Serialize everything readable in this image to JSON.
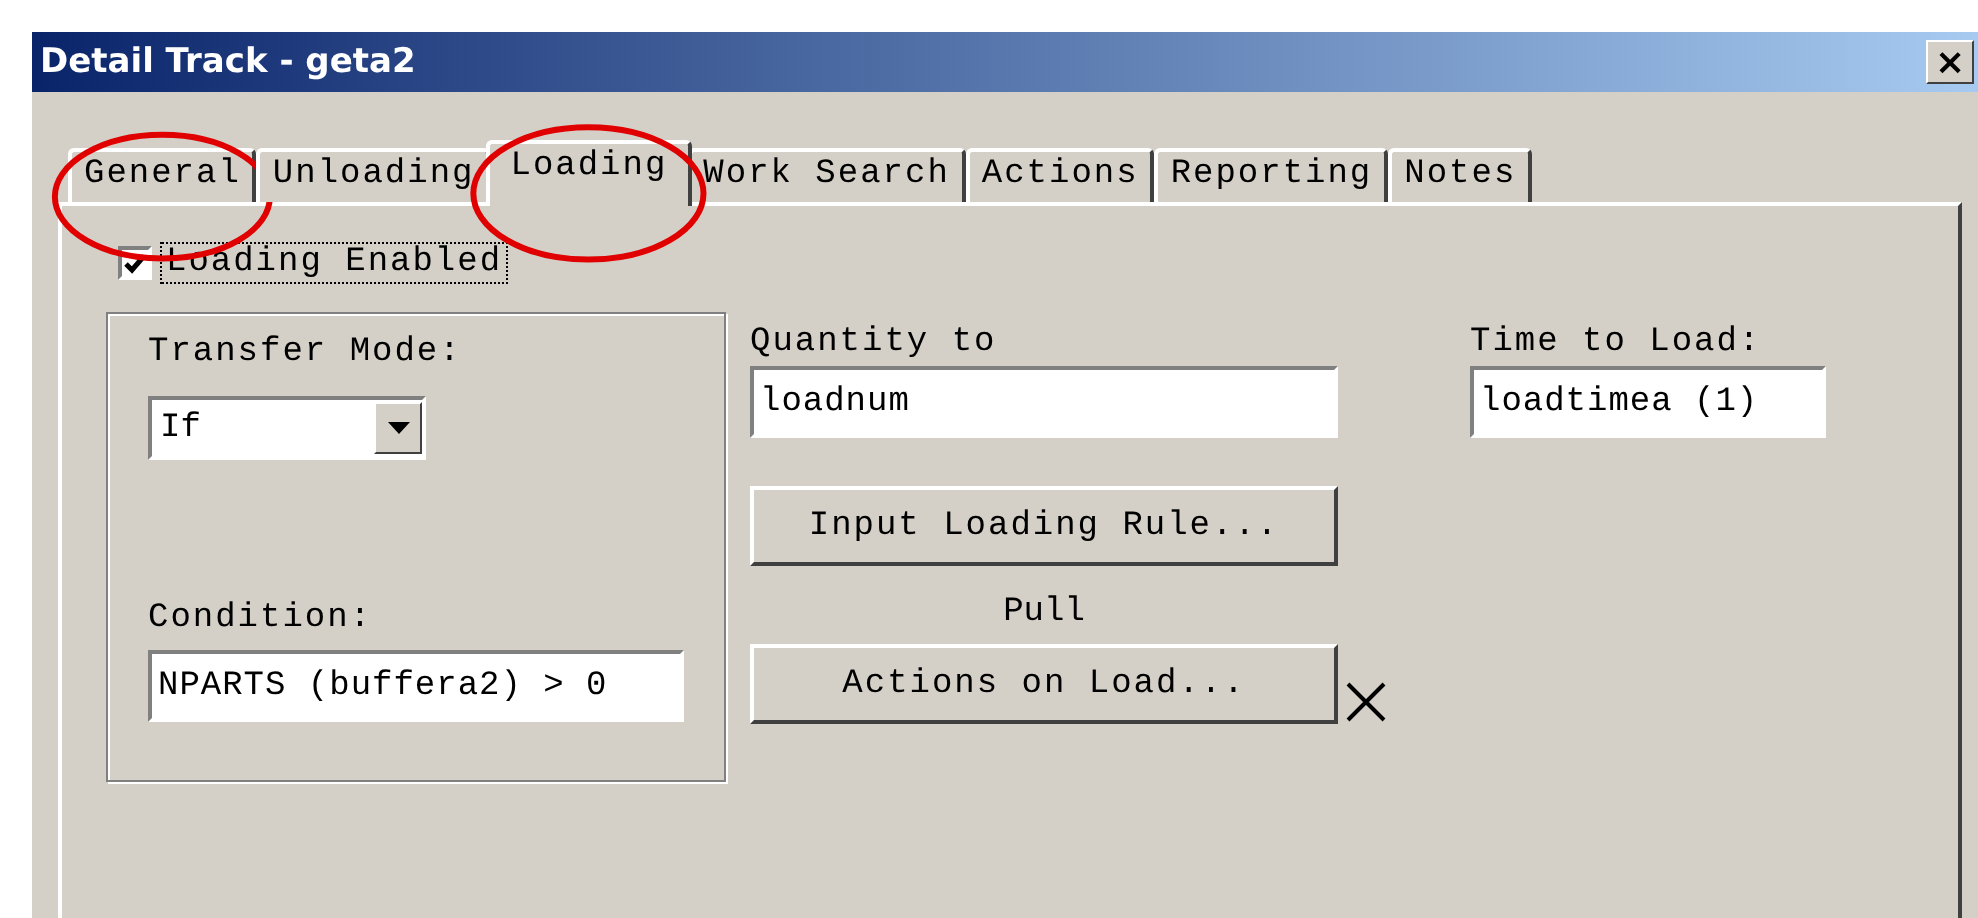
{
  "window": {
    "title": "Detail Track - geta2",
    "close": "×"
  },
  "tabs": [
    {
      "label": "General",
      "selected": false,
      "circled": true
    },
    {
      "label": "Unloading",
      "selected": false,
      "circled": false
    },
    {
      "label": "Loading",
      "selected": true,
      "circled": true
    },
    {
      "label": "Work Search",
      "selected": false,
      "circled": false
    },
    {
      "label": "Actions",
      "selected": false,
      "circled": false
    },
    {
      "label": "Reporting",
      "selected": false,
      "circled": false
    },
    {
      "label": "Notes",
      "selected": false,
      "circled": false
    }
  ],
  "loading_enabled": {
    "label": "Loading Enabled",
    "checked": true
  },
  "transfer_mode": {
    "label": "Transfer Mode:",
    "value": "If"
  },
  "condition": {
    "label": "Condition:",
    "value": "NPARTS (buffera2) > 0"
  },
  "quantity": {
    "label": "Quantity to",
    "value": "loadnum"
  },
  "input_rule_button": "Input Loading Rule...",
  "pull_label": "Pull",
  "actions_button": "Actions on Load...",
  "time_to_load": {
    "label": "Time to Load:",
    "value": "loadtimea (1)"
  }
}
